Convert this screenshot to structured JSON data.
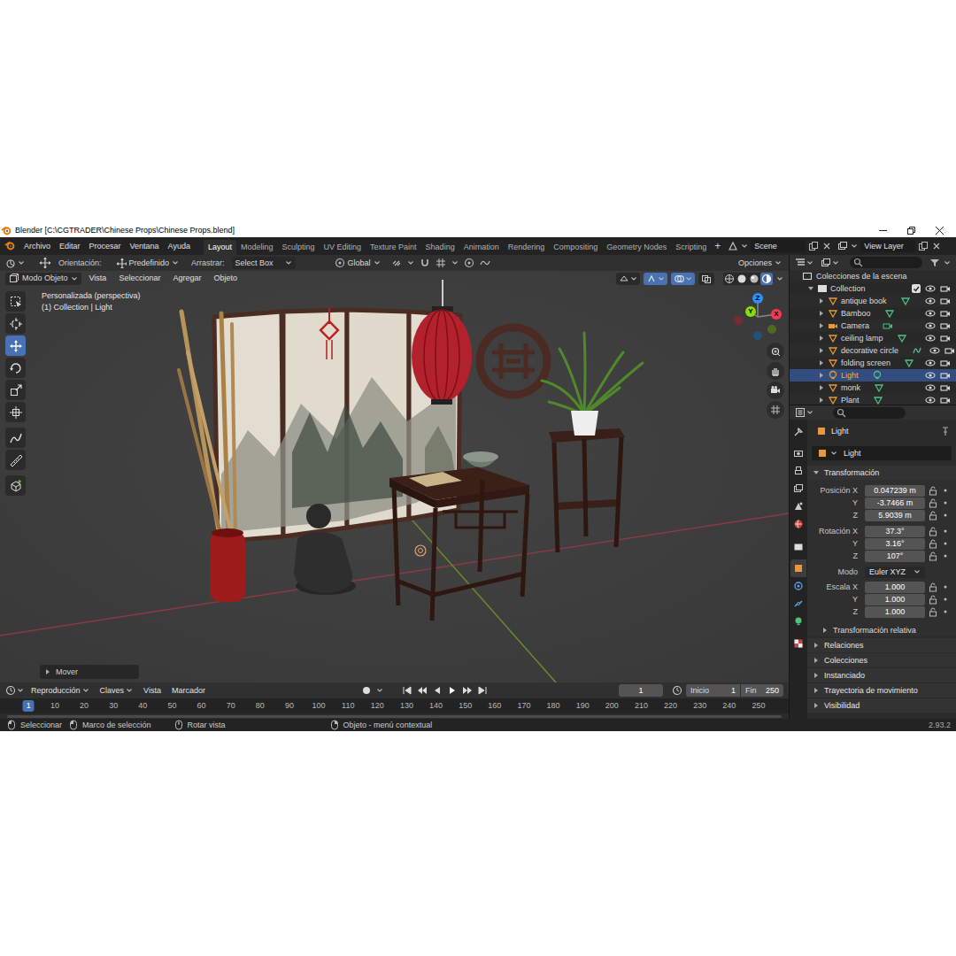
{
  "window": {
    "title": "Blender [C:\\CGTRADER\\Chinese Props\\Chinese Props.blend]"
  },
  "menu": [
    "Archivo",
    "Editar",
    "Procesar",
    "Ventana",
    "Ayuda"
  ],
  "workspaces": [
    {
      "label": "Layout",
      "selected": true
    },
    {
      "label": "Modeling",
      "selected": false
    },
    {
      "label": "Sculpting",
      "selected": false
    },
    {
      "label": "UV Editing",
      "selected": false
    },
    {
      "label": "Texture Paint",
      "selected": false
    },
    {
      "label": "Shading",
      "selected": false
    },
    {
      "label": "Animation",
      "selected": false
    },
    {
      "label": "Rendering",
      "selected": false
    },
    {
      "label": "Compositing",
      "selected": false
    },
    {
      "label": "Geometry Nodes",
      "selected": false
    },
    {
      "label": "Scripting",
      "selected": false
    }
  ],
  "add_workspace": "+",
  "scene": "Scene",
  "view_layer": "View Layer",
  "tool_header": {
    "orientation_label": "Orientación:",
    "orientation": "Predefinido",
    "drag_label": "Arrastrar:",
    "drag": "Select Box",
    "transform_orientation": "Global",
    "options": "Opciones"
  },
  "viewport_header": {
    "mode": "Modo Objeto",
    "menus": [
      "Vista",
      "Seleccionar",
      "Agregar",
      "Objeto"
    ],
    "toggles": [
      {
        "kind": "visibility",
        "on": false
      },
      {
        "kind": "gizmos",
        "on": true
      },
      {
        "kind": "overlays",
        "on": true
      },
      {
        "kind": "xray",
        "on": false
      }
    ],
    "shading": [
      {
        "kind": "wireframe",
        "selected": false
      },
      {
        "kind": "solid",
        "selected": false
      },
      {
        "kind": "material",
        "selected": false
      },
      {
        "kind": "rendered",
        "selected": true
      }
    ]
  },
  "viewport": {
    "view_name": "Personalizada (perspectiva)",
    "context": "(1) Collection | Light",
    "last_operator": "Mover",
    "last_operator_expanded": false,
    "gizmo_axes": [
      {
        "label": "X",
        "color": "#ff3352"
      },
      {
        "label": "Y",
        "color": "#8bdc00"
      },
      {
        "label": "Z",
        "color": "#2890ff"
      }
    ]
  },
  "toolbar": [
    {
      "kind": "select",
      "selected": false
    },
    {
      "kind": "cursor",
      "selected": false
    },
    {
      "kind": "move",
      "selected": true
    },
    {
      "kind": "rotate",
      "selected": false
    },
    {
      "kind": "scale",
      "selected": false
    },
    {
      "kind": "transform",
      "selected": false
    },
    {
      "kind": "annotate",
      "selected": false
    },
    {
      "kind": "measure",
      "selected": false
    },
    {
      "kind": "add-cube",
      "selected": false
    }
  ],
  "outliner": {
    "root": "Colecciones de la escena",
    "collection": {
      "name": "Collection",
      "checked": true,
      "expanded": true,
      "visible": true,
      "renderable": true
    },
    "items": [
      {
        "name": "antique book",
        "kind": "mesh",
        "selected": false,
        "visible": true,
        "renderable": true
      },
      {
        "name": "Bamboo",
        "kind": "mesh",
        "selected": false,
        "visible": true,
        "renderable": true
      },
      {
        "name": "Camera",
        "kind": "camera",
        "selected": false,
        "visible": true,
        "renderable": true
      },
      {
        "name": "ceiling lamp",
        "kind": "mesh",
        "selected": false,
        "visible": true,
        "renderable": true
      },
      {
        "name": "decorative circle",
        "kind": "curve",
        "selected": false,
        "visible": true,
        "renderable": true
      },
      {
        "name": "folding screen",
        "kind": "mesh",
        "selected": false,
        "visible": true,
        "renderable": true
      },
      {
        "name": "Light",
        "kind": "light",
        "selected": true,
        "visible": true,
        "renderable": true
      },
      {
        "name": "monk",
        "kind": "mesh",
        "selected": false,
        "visible": true,
        "renderable": true
      },
      {
        "name": "Plant",
        "kind": "mesh",
        "selected": false,
        "visible": true,
        "renderable": true
      }
    ]
  },
  "properties": {
    "tabs": [
      {
        "kind": "tool",
        "selected": false
      },
      {
        "kind": "render",
        "selected": false
      },
      {
        "kind": "output",
        "selected": false
      },
      {
        "kind": "view-layer",
        "selected": false
      },
      {
        "kind": "scene",
        "selected": false
      },
      {
        "kind": "world",
        "selected": false
      },
      {
        "kind": "collection",
        "selected": false
      },
      {
        "kind": "object",
        "selected": true
      },
      {
        "kind": "physics",
        "selected": false
      },
      {
        "kind": "constraints",
        "selected": false
      },
      {
        "kind": "light-data",
        "selected": false
      },
      {
        "kind": "texture",
        "selected": false
      }
    ],
    "object_name": "Light",
    "data_block": "Light",
    "transform": {
      "label": "Transformación",
      "expanded": true,
      "location": [
        {
          "label": "Posición X",
          "value": "0.047239 m",
          "locked": false
        },
        {
          "label": "Y",
          "value": "-3.7466 m",
          "locked": false
        },
        {
          "label": "Z",
          "value": "5.9039 m",
          "locked": false
        }
      ],
      "rotation": [
        {
          "label": "Rotación X",
          "value": "37.3°",
          "locked": false
        },
        {
          "label": "Y",
          "value": "3.16°",
          "locked": false
        },
        {
          "label": "Z",
          "value": "107°",
          "locked": false
        }
      ],
      "mode": {
        "label": "Modo",
        "value": "Euler XYZ"
      },
      "scale": [
        {
          "label": "Escala X",
          "value": "1.000",
          "locked": false
        },
        {
          "label": "Y",
          "value": "1.000",
          "locked": false
        },
        {
          "label": "Z",
          "value": "1.000",
          "locked": false
        }
      ],
      "delta": {
        "label": "Transformación relativa",
        "expanded": false
      }
    },
    "panels": [
      {
        "label": "Relaciones",
        "expanded": false
      },
      {
        "label": "Colecciones",
        "expanded": false
      },
      {
        "label": "Instanciado",
        "expanded": false
      },
      {
        "label": "Trayectoria de movimiento",
        "expanded": false
      },
      {
        "label": "Visibilidad",
        "expanded": false
      }
    ]
  },
  "timeline": {
    "menus": [
      {
        "label": "Reproducción",
        "dropdown": true
      },
      {
        "label": "Claves",
        "dropdown": true
      },
      {
        "label": "Vista",
        "dropdown": false
      },
      {
        "label": "Marcador",
        "dropdown": false
      }
    ],
    "current_frame": "1",
    "start_label": "Inicio",
    "start": "1",
    "end_label": "Fin",
    "end": "250",
    "playhead": "1",
    "ruler": [
      "10",
      "20",
      "30",
      "40",
      "50",
      "60",
      "70",
      "80",
      "90",
      "100",
      "110",
      "120",
      "130",
      "140",
      "150",
      "160",
      "170",
      "180",
      "190",
      "200",
      "210",
      "220",
      "230",
      "240",
      "250"
    ]
  },
  "status_bar": {
    "items": [
      "Seleccionar",
      "Marco de selección",
      "Rotar vista",
      "Objeto - menú contextual"
    ],
    "version": "2.93.2"
  }
}
